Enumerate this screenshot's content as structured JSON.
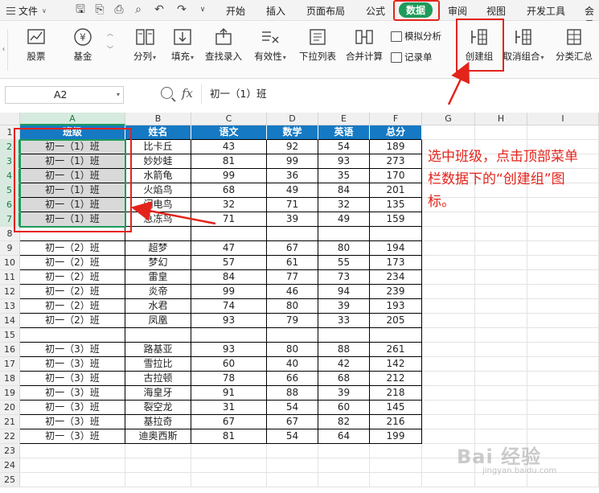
{
  "menubar": {
    "file_label": "文件",
    "tabs": [
      "开始",
      "插入",
      "页面布局",
      "公式",
      "数据",
      "审阅",
      "视图",
      "开发工具",
      "会员"
    ],
    "active_tab": "数据"
  },
  "ribbon": {
    "stocks_label": "股票",
    "fund_label": "基金",
    "split_label": "分列",
    "fill_label": "填充",
    "find_entry_label": "查找录入",
    "validity_label": "有效性",
    "dropdown_list_label": "下拉列表",
    "merge_calc_label": "合并计算",
    "simulate_label": "模拟分析",
    "record_label": "记录单",
    "create_group_label": "创建组",
    "ungroup_label": "取消组合",
    "subtotal_label": "分类汇总"
  },
  "formula_bar": {
    "cell_ref": "A2",
    "fx": "fx",
    "content": "初一（1）班"
  },
  "sheet": {
    "columns": [
      "A",
      "B",
      "C",
      "D",
      "E",
      "F",
      "G",
      "H",
      "I"
    ],
    "row_numbers": [
      "1",
      "2",
      "3",
      "4",
      "5",
      "6",
      "7",
      "8",
      "9",
      "10",
      "11",
      "12",
      "13",
      "14",
      "15",
      "16",
      "17",
      "18",
      "19",
      "20",
      "21",
      "22",
      "23",
      "24",
      "25"
    ],
    "headers": [
      "班级",
      "姓名",
      "语文",
      "数学",
      "英语",
      "总分"
    ],
    "rows": [
      {
        "row": "2",
        "cells": [
          "初一（1）班",
          "比卡丘",
          "43",
          "92",
          "54",
          "189"
        ]
      },
      {
        "row": "3",
        "cells": [
          "初一（1）班",
          "妙妙蛙",
          "81",
          "99",
          "93",
          "273"
        ]
      },
      {
        "row": "4",
        "cells": [
          "初一（1）班",
          "水箭龟",
          "99",
          "36",
          "35",
          "170"
        ]
      },
      {
        "row": "5",
        "cells": [
          "初一（1）班",
          "火焰鸟",
          "68",
          "49",
          "84",
          "201"
        ]
      },
      {
        "row": "6",
        "cells": [
          "初一（1）班",
          "闪电鸟",
          "32",
          "71",
          "32",
          "135"
        ]
      },
      {
        "row": "7",
        "cells": [
          "初一（1）班",
          "急冻鸟",
          "71",
          "39",
          "49",
          "159"
        ]
      },
      {
        "row": "9",
        "cells": [
          "初一（2）班",
          "超梦",
          "47",
          "67",
          "80",
          "194"
        ]
      },
      {
        "row": "10",
        "cells": [
          "初一（2）班",
          "梦幻",
          "57",
          "61",
          "55",
          "173"
        ]
      },
      {
        "row": "11",
        "cells": [
          "初一（2）班",
          "雷皇",
          "84",
          "77",
          "73",
          "234"
        ]
      },
      {
        "row": "12",
        "cells": [
          "初一（2）班",
          "炎帝",
          "99",
          "46",
          "94",
          "239"
        ]
      },
      {
        "row": "13",
        "cells": [
          "初一（2）班",
          "水君",
          "74",
          "80",
          "39",
          "193"
        ]
      },
      {
        "row": "14",
        "cells": [
          "初一（2）班",
          "凤凰",
          "93",
          "79",
          "33",
          "205"
        ]
      },
      {
        "row": "16",
        "cells": [
          "初一（3）班",
          "路基亚",
          "93",
          "80",
          "88",
          "261"
        ]
      },
      {
        "row": "17",
        "cells": [
          "初一（3）班",
          "雪拉比",
          "60",
          "40",
          "42",
          "142"
        ]
      },
      {
        "row": "18",
        "cells": [
          "初一（3）班",
          "古拉顿",
          "78",
          "66",
          "68",
          "212"
        ]
      },
      {
        "row": "19",
        "cells": [
          "初一（3）班",
          "海皇牙",
          "91",
          "88",
          "39",
          "218"
        ]
      },
      {
        "row": "20",
        "cells": [
          "初一（3）班",
          "裂空龙",
          "31",
          "54",
          "60",
          "145"
        ]
      },
      {
        "row": "21",
        "cells": [
          "初一（3）班",
          "基拉奇",
          "67",
          "67",
          "82",
          "216"
        ]
      },
      {
        "row": "22",
        "cells": [
          "初一（3）班",
          "迪奥西斯",
          "81",
          "54",
          "64",
          "199"
        ]
      }
    ]
  },
  "annotation": {
    "text": "选中班级，点击顶部菜单栏数据下的“创建组”图标。",
    "color": "#e3241b"
  },
  "watermark": {
    "text": "Bai 经验",
    "sub": "jingyan.baidu.com"
  },
  "colors": {
    "accent": "#1e9b5a",
    "header_fill": "#1679c3",
    "annotation_red": "#e3241b",
    "selection_fill": "#d9d9d9"
  }
}
